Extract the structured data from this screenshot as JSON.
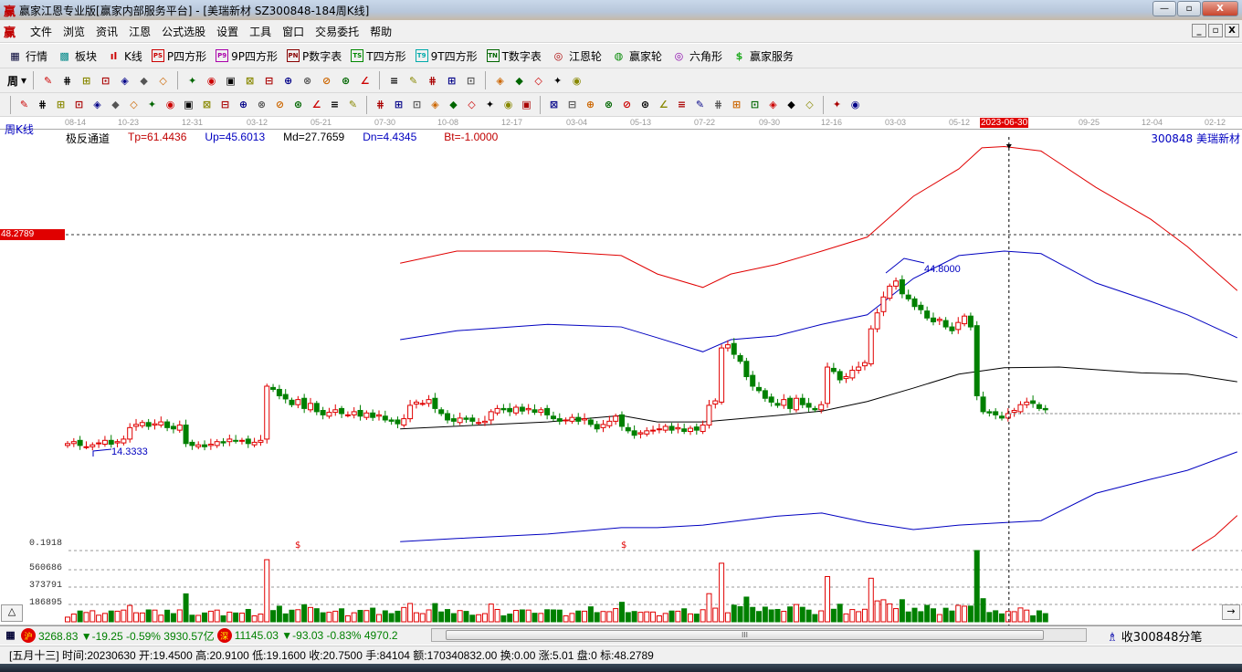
{
  "window": {
    "logo": "赢",
    "title": "赢家江恩专业版[赢家内部服务平台] - [美瑞新材  SZ300848-184周K线]",
    "min": "—",
    "max": "▫",
    "close": "X"
  },
  "menu": [
    "文件",
    "浏览",
    "资讯",
    "江恩",
    "公式选股",
    "设置",
    "工具",
    "窗口",
    "交易委托",
    "帮助"
  ],
  "toolbar1": [
    {
      "icon": "grid-icon",
      "glyph": "▦",
      "label": "行情",
      "color": "#003"
    },
    {
      "icon": "blocks-icon",
      "glyph": "▩",
      "label": "板块",
      "color": "#088"
    },
    {
      "icon": "kline-icon",
      "glyph": "ıl",
      "label": "K线",
      "color": "#c00"
    },
    {
      "icon": "ps-icon",
      "glyph": "PS",
      "label": "P四方形",
      "color": "#c00"
    },
    {
      "icon": "p9-icon",
      "glyph": "P9",
      "label": "9P四方形",
      "color": "#a0a"
    },
    {
      "icon": "pn-icon",
      "glyph": "PN",
      "label": "P数字表",
      "color": "#800"
    },
    {
      "icon": "ts-icon",
      "glyph": "TS",
      "label": "T四方形",
      "color": "#080"
    },
    {
      "icon": "t9-icon",
      "glyph": "T9",
      "label": "9T四方形",
      "color": "#0aa"
    },
    {
      "icon": "tn-icon",
      "glyph": "TN",
      "label": "T数字表",
      "color": "#060"
    },
    {
      "icon": "gann-wheel-icon",
      "glyph": "◎",
      "label": "江恩轮",
      "color": "#a00"
    },
    {
      "icon": "winner-wheel-icon",
      "glyph": "◍",
      "label": "赢家轮",
      "color": "#080"
    },
    {
      "icon": "hexagon-icon",
      "glyph": "◎",
      "label": "六角形",
      "color": "#80a"
    },
    {
      "icon": "dollar-icon",
      "glyph": "$",
      "label": "赢家服务",
      "color": "#2a2"
    }
  ],
  "toolbar2": {
    "period": "周",
    "icons": [
      "tool-a-icon",
      "tool-b-icon",
      "tool-c-icon",
      "tool-d-icon",
      "candle-type-icon",
      "ji-icon",
      "flag-icon",
      "first-icon",
      "last-icon",
      "left-icon",
      "right-icon",
      "zoom-left-icon",
      "zoom-right-icon",
      "zoom-horiz-icon",
      "zoom-in-icon",
      "zoom-out-icon",
      "zoom-all-icon",
      "hand-icon",
      "crosshair-icon",
      "line-draw-icon",
      "jie-icon",
      "draw-icon",
      "calendar-icon",
      "calculator-icon",
      "notes-icon",
      "save-icon",
      "print-icon"
    ]
  },
  "toolbar3": {
    "icons": [
      "pen-icon",
      "parallel-icon",
      "gold1-icon",
      "gold2-icon",
      "f-icon",
      "spiral-icon",
      "pen2-icon",
      "circle-icon",
      "lines-icon",
      "n2-icon",
      "angle-icon",
      "target-icon",
      "star-icon",
      "square-icon",
      "fan-icon",
      "shen-icon",
      "ying-icon",
      "box-icon",
      "range-icon",
      "rect-icon",
      "fan2-icon",
      "square2-icon",
      "square3-icon",
      "angle2-icon",
      "wave-icon",
      "grid2-icon",
      "grid3-icon",
      "slash-icon",
      "bars-icon",
      "tpercent-icon",
      "percent-icon",
      "percent-line-icon",
      "gold-circle-icon",
      "gold-line-icon",
      "arrow-icon",
      "sine-icon",
      "gold-sq-icon",
      "j-icon",
      "f-angle-icon",
      "gold-angle-icon",
      "shen-angle-icon",
      "ying-angle-icon",
      "four-angle-icon",
      "taiji-icon",
      "infinity-icon"
    ]
  },
  "chart": {
    "period_label": "周K线",
    "indicator": {
      "name": "极反通道",
      "tp": "Tp=61.4436",
      "up": "Up=45.6013",
      "md": "Md=27.7659",
      "dn": "Dn=4.4345",
      "bt": "Bt=-1.0000"
    },
    "stock": "300848  美瑞新材",
    "dates": [
      "08-14",
      "10-23",
      "12-31",
      "03-12",
      "05-21",
      "07-30",
      "10-08",
      "12-17",
      "03-04",
      "05-13",
      "07-22",
      "09-30",
      "12-16",
      "03-03",
      "05-12",
      "2023-06-30",
      "09-25",
      "12-04",
      "02-12"
    ],
    "price_line_label": "48.2789",
    "high_label": "44.8000",
    "low_label": "14.3333",
    "vol_labels": [
      "0.1918",
      "560686",
      "373791",
      "186895"
    ],
    "dollar": "$",
    "up_label": "△",
    "right_arrow": "→"
  },
  "chart_data": {
    "type": "candlestick",
    "closes": [
      15.5,
      15.8,
      15.2,
      15.0,
      15.3,
      15.6,
      16.0,
      15.4,
      15.8,
      16.2,
      18.0,
      18.5,
      18.8,
      18.2,
      18.6,
      18.9,
      18.0,
      17.8,
      18.4,
      15.5,
      15.2,
      15.3,
      15.0,
      15.4,
      15.8,
      15.6,
      16.2,
      15.9,
      16.0,
      15.5,
      15.7,
      16.0,
      24.5,
      24.0,
      23.0,
      22.5,
      21.6,
      22.4,
      21.0,
      21.8,
      20.5,
      20.0,
      20.4,
      20.8,
      20.2,
      20.0,
      20.5,
      19.8,
      20.3,
      19.6,
      20.0,
      19.2,
      19.0,
      18.6,
      19.4,
      21.5,
      22.0,
      21.8,
      22.4,
      21.0,
      20.2,
      19.2,
      19.0,
      19.5,
      19.3,
      19.0,
      18.8,
      19.0,
      20.5,
      21.0,
      20.8,
      20.5,
      21.2,
      20.6,
      21.0,
      20.4,
      20.8,
      20.0,
      19.4,
      19.0,
      19.2,
      19.6,
      19.0,
      19.4,
      18.5,
      17.8,
      18.5,
      19.0,
      19.8,
      18.2,
      17.5,
      16.8,
      17.2,
      17.5,
      17.6,
      17.8,
      18.2,
      17.6,
      18.0,
      17.4,
      17.9,
      17.6,
      18.4,
      21.5,
      22.2,
      30.5,
      31.0,
      29.5,
      28.4,
      26.0,
      24.5,
      23.8,
      22.6,
      22.0,
      21.5,
      22.4,
      21.0,
      22.6,
      21.6,
      21.2,
      20.8,
      21.6,
      27.5,
      26.8,
      25.5,
      26.0,
      27.0,
      27.5,
      28.2,
      33.5,
      36.0,
      38.5,
      40.2,
      41.0,
      39.0,
      38.2,
      37.0,
      36.5,
      35.2,
      34.6,
      35.0,
      33.8,
      33.2,
      34.5,
      35.5,
      33.8,
      23.0,
      20.5,
      20.3,
      20.0,
      19.5,
      20.2,
      20.7,
      21.6,
      22.0,
      21.8,
      21.0,
      20.8
    ],
    "selected_index": 151,
    "bands": {
      "red_upper": [
        [
          53.4,
          43.8
        ],
        [
          62.5,
          45.7
        ],
        [
          77.1,
          45.7
        ],
        [
          88.9,
          45.0
        ],
        [
          94.7,
          42.1
        ],
        [
          102,
          40.0
        ],
        [
          106.5,
          42.1
        ],
        [
          113.8,
          43.6
        ],
        [
          121.1,
          45.7
        ],
        [
          128.4,
          47.9
        ],
        [
          135.8,
          54.3
        ],
        [
          143.1,
          58.6
        ],
        [
          146.8,
          61.9
        ],
        [
          150.4,
          62.1
        ],
        [
          156.3,
          61.4
        ],
        [
          165.1,
          55.7
        ],
        [
          173.9,
          50.7
        ],
        [
          179.8,
          46.4
        ],
        [
          187.8,
          39.5
        ]
      ],
      "blue_upper": [
        [
          53.4,
          31.8
        ],
        [
          62.5,
          33.2
        ],
        [
          77.1,
          34.2
        ],
        [
          88.9,
          33.8
        ],
        [
          94.7,
          32.1
        ],
        [
          102,
          29.9
        ],
        [
          106.5,
          31.8
        ],
        [
          113.8,
          32.4
        ],
        [
          121.1,
          34.2
        ],
        [
          128.4,
          35.7
        ],
        [
          135.8,
          41.4
        ],
        [
          143.1,
          45.0
        ],
        [
          150.4,
          45.7
        ],
        [
          156.3,
          45.3
        ],
        [
          165.1,
          40.7
        ],
        [
          173.9,
          37.8
        ],
        [
          179.8,
          35.7
        ],
        [
          187.8,
          32.1
        ]
      ],
      "middle": [
        [
          53.4,
          17.8
        ],
        [
          77.1,
          18.9
        ],
        [
          88.9,
          19.9
        ],
        [
          94.7,
          18.9
        ],
        [
          102,
          18.9
        ],
        [
          113.8,
          19.9
        ],
        [
          121.1,
          20.6
        ],
        [
          128.4,
          22.1
        ],
        [
          135.8,
          24.2
        ],
        [
          143.1,
          26.4
        ],
        [
          150.4,
          27.4
        ],
        [
          159.2,
          27.5
        ],
        [
          172.4,
          26.6
        ],
        [
          179.8,
          26.4
        ],
        [
          187.8,
          25.2
        ]
      ],
      "blue_lower": [
        [
          53.4,
          0.1
        ],
        [
          62.5,
          0.6
        ],
        [
          77.1,
          1.3
        ],
        [
          88.9,
          2.3
        ],
        [
          94.7,
          2.3
        ],
        [
          102,
          2.7
        ],
        [
          113.8,
          4.1
        ],
        [
          121.1,
          4.6
        ],
        [
          128.4,
          3.1
        ],
        [
          135.8,
          2.0
        ],
        [
          143.1,
          2.7
        ],
        [
          150.4,
          3.1
        ],
        [
          156.3,
          3.4
        ],
        [
          165.1,
          7.7
        ],
        [
          173.9,
          9.9
        ],
        [
          179.8,
          11.3
        ],
        [
          187.8,
          14.2
        ]
      ],
      "red_lower": [
        [
          180.5,
          -1.3
        ],
        [
          184.2,
          1.0
        ],
        [
          187.8,
          4.2
        ]
      ]
    }
  },
  "indexbar": {
    "sh_badge": "沪",
    "sh": "3268.83 ▼-19.25 -0.59% 3930.57亿",
    "sz_badge": "深",
    "sz": "11145.03 ▼-93.03 -0.83% 4970.2",
    "scroll_thumb": "III",
    "fenbi": "收300848分笔"
  },
  "status": "[五月十三] 时间:20230630 开:19.4500 高:20.9100 低:19.1600 收:20.7500 手:84104 额:170340832.00 换:0.00 涨:5.01 盘:0 标:48.2789"
}
